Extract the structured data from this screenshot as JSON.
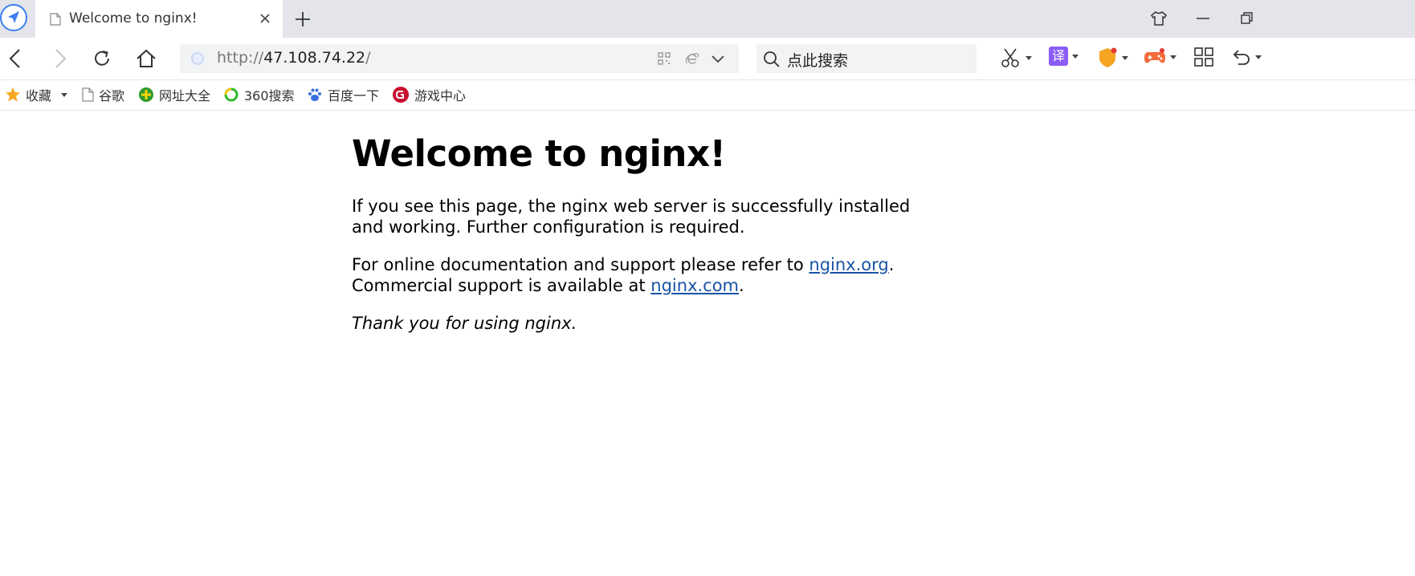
{
  "browser": {
    "tab": {
      "title": "Welcome to nginx!"
    },
    "address": {
      "scheme": "http://",
      "host": "47.108.74.22",
      "path": "/"
    },
    "search": {
      "placeholder": "点此搜索"
    },
    "bookmarks": [
      {
        "label": "收藏",
        "icon": "star-icon"
      },
      {
        "label": "谷歌",
        "icon": "page-icon"
      },
      {
        "label": "网址大全",
        "icon": "web-directory-icon"
      },
      {
        "label": "360搜索",
        "icon": "360-search-icon"
      },
      {
        "label": "百度一下",
        "icon": "baidu-paw-icon"
      },
      {
        "label": "游戏中心",
        "icon": "game-center-icon"
      }
    ],
    "toolbar": {
      "translate_label": "译",
      "wallet_label": "¥"
    }
  },
  "page": {
    "heading": "Welcome to nginx!",
    "para1": "If you see this page, the nginx web server is successfully installed and working. Further configuration is required.",
    "para2_prefix": "For online documentation and support please refer to ",
    "para2_link": "nginx.org",
    "para2_suffix": ".",
    "para3_prefix": "Commercial support is available at ",
    "para3_link": "nginx.com",
    "para3_suffix": ".",
    "thanks": "Thank you for using nginx."
  },
  "colors": {
    "link": "#1a53a6",
    "tabstrip": "#e3e5ea",
    "accent_blue": "#3d7ff0",
    "translate_purple": "#8b5cf6",
    "shield_orange": "#f5a623",
    "game_orange": "#f26b3a"
  }
}
